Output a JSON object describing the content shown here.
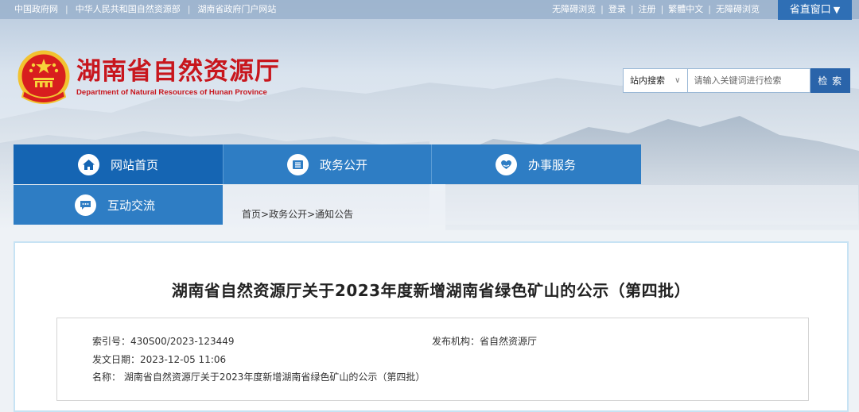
{
  "topbar": {
    "left_links": [
      "中国政府网",
      "中华人民共和国自然资源部",
      "湖南省政府门户网站"
    ],
    "right_links": [
      "无障碍浏览",
      "登录",
      "注册",
      "繁體中文",
      "无障碍浏览"
    ],
    "portal_label": "省直窗口",
    "portal_caret": "▼"
  },
  "header": {
    "title_cn": "湖南省自然资源厅",
    "title_en": "Department of Natural Resources of Hunan Province"
  },
  "search": {
    "scope": "站内搜索",
    "placeholder": "请输入关键词进行检索",
    "button": "检 索"
  },
  "nav": {
    "items": [
      {
        "label": "网站首页",
        "icon": "home-icon"
      },
      {
        "label": "政务公开",
        "icon": "document-icon"
      },
      {
        "label": "办事服务",
        "icon": "heart-hand-icon"
      },
      {
        "label": "互动交流",
        "icon": "chat-icon"
      }
    ]
  },
  "breadcrumb": {
    "items": [
      "首页",
      "政务公开",
      "通知公告"
    ],
    "sep": ">"
  },
  "article": {
    "title": "湖南省自然资源厅关于2023年度新增湖南省绿色矿山的公示（第四批）",
    "index_no": "索引号：430S00/2023-123449",
    "publisher": "发布机构：省自然资源厅",
    "date": "发文日期：2023-12-05 11:06",
    "name": "名称： 湖南省自然资源厅关于2023年度新增湖南省绿色矿山的公示（第四批）"
  },
  "colors": {
    "nav_active": "#1565b3",
    "nav_default": "#2e7dc4",
    "title_red": "#c8161d",
    "search_button": "#2a64aa"
  }
}
